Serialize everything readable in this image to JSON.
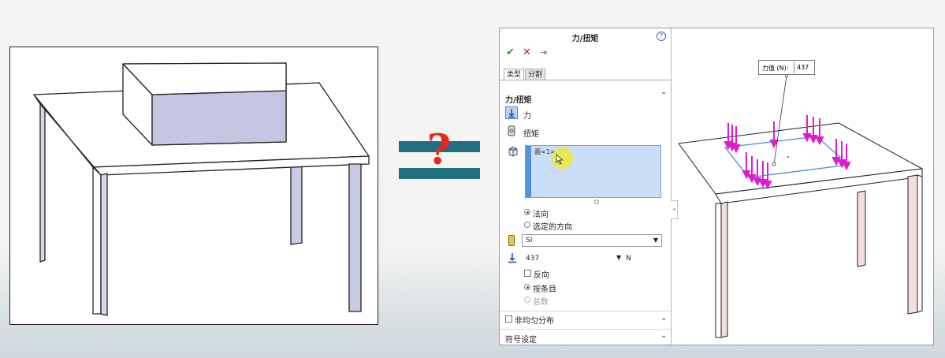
{
  "panel": {
    "title": "力/扭矩",
    "help_icon": "question-circle-icon",
    "toolbar": {
      "ok_icon": "checkmark-icon",
      "cancel_icon": "x-icon",
      "pin_icon": "pushpin-icon"
    },
    "tabs": [
      {
        "label": "类型",
        "active": true
      },
      {
        "label": "分割",
        "active": false
      }
    ],
    "force_section": {
      "header": "力/扭矩",
      "options": [
        {
          "label": "力",
          "selected": true
        },
        {
          "label": "扭矩",
          "selected": false
        }
      ],
      "selection_list": {
        "items": [
          "面<1>"
        ]
      },
      "direction": [
        {
          "label": "法向",
          "checked": true
        },
        {
          "label": "选定的方向",
          "checked": false
        }
      ],
      "unit_system": "SI",
      "force_value": "437",
      "force_unit": "N",
      "reverse": {
        "label": "反向",
        "checked": false
      },
      "per_item": [
        {
          "label": "按条目",
          "checked": true,
          "enabled": true
        },
        {
          "label": "总数",
          "checked": false,
          "enabled": false
        }
      ]
    },
    "nonuniform": {
      "label": "非均匀分布",
      "checked": false
    },
    "symbol_settings": {
      "label": "符号设定"
    }
  },
  "viewport": {
    "callout": {
      "label": "力值 (N):",
      "value": "437"
    }
  },
  "colors": {
    "arrow": "#e01ad0",
    "table_leg": "#f3dede",
    "box_side": "#c4c6e2",
    "selection": "#cadff7",
    "accent_teal": "#1f6f80",
    "question_red": "#e8281c"
  }
}
